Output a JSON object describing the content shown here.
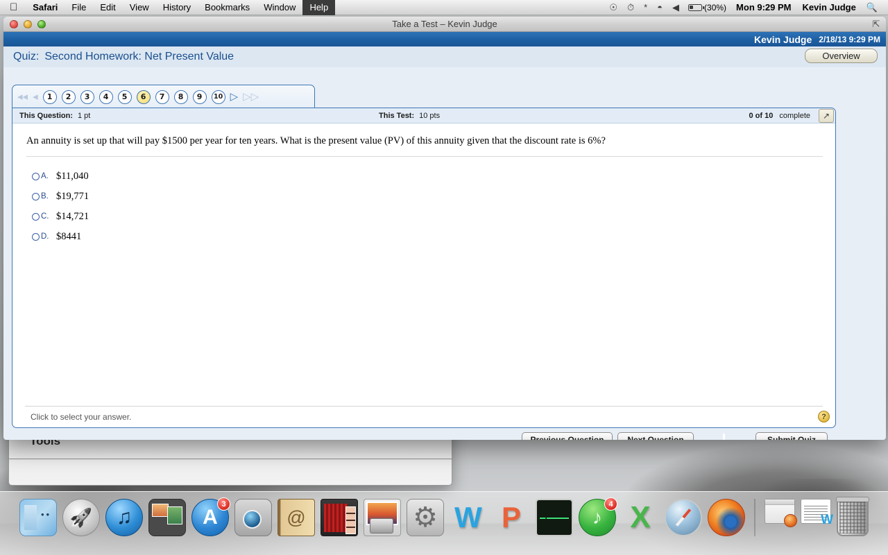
{
  "menubar": {
    "apple_icon": "apple-icon",
    "items": [
      {
        "label": "Safari",
        "bold": true,
        "active": false
      },
      {
        "label": "File",
        "bold": false,
        "active": false
      },
      {
        "label": "Edit",
        "bold": false,
        "active": false
      },
      {
        "label": "View",
        "bold": false,
        "active": false
      },
      {
        "label": "History",
        "bold": false,
        "active": false
      },
      {
        "label": "Bookmarks",
        "bold": false,
        "active": false
      },
      {
        "label": "Window",
        "bold": false,
        "active": false
      },
      {
        "label": "Help",
        "bold": false,
        "active": true
      }
    ],
    "status": {
      "dropbox_icon": "dropbox-icon",
      "timemachine_icon": "time-machine-icon",
      "bluetooth_icon": "bluetooth-icon",
      "wifi_icon": "wifi-icon",
      "volume_icon": "volume-icon",
      "battery_icon": "battery-icon",
      "battery_percent": "(30%)",
      "clock": "Mon 9:29 PM",
      "user": "Kevin Judge",
      "spotlight_icon": "search-icon"
    }
  },
  "window": {
    "title": "Take a Test – Kevin Judge",
    "close_label": "close",
    "minimize_label": "minimize",
    "zoom_label": "zoom",
    "fullscreen_icon": "fullscreen-icon"
  },
  "userbar": {
    "name": "Kevin Judge",
    "datetime": "2/18/13 9:29 PM"
  },
  "quiz_header": {
    "label": "Quiz:",
    "title": "Second Homework: Net Present Value",
    "overview_button": "Overview"
  },
  "question_nav": {
    "first_label": "first",
    "prev_label": "previous",
    "next_label": "next",
    "last_label": "last",
    "numbers": [
      "1",
      "2",
      "3",
      "4",
      "5",
      "6",
      "7",
      "8",
      "9",
      "10"
    ],
    "current": "6"
  },
  "score_bar": {
    "this_question_label": "This Question:",
    "this_question_value": "1 pt",
    "this_test_label": "This Test:",
    "this_test_value": "10 pts",
    "progress_value": "0 of 10",
    "progress_label": "complete",
    "expand_icon": "expand-icon"
  },
  "question": {
    "text": "An annuity is set up that will pay $1500 per year for ten years. What is the present value (PV) of this annuity given that the discount rate is 6%?",
    "choices": [
      {
        "letter": "A.",
        "value": "$11,040",
        "selected": false
      },
      {
        "letter": "B.",
        "value": "$19,771",
        "selected": false
      },
      {
        "letter": "C.",
        "value": "$14,721",
        "selected": false
      },
      {
        "letter": "D.",
        "value": "$8441",
        "selected": false
      }
    ],
    "hint": "Click to select your answer.",
    "help_icon": "?"
  },
  "actions": {
    "previous": "Previous Question",
    "next": "Next Question",
    "submit": "Submit Quiz"
  },
  "background_window": {
    "title": "Tools"
  },
  "dock": {
    "items": [
      {
        "name": "finder",
        "class": "ic-finder",
        "badge": ""
      },
      {
        "name": "launchpad",
        "class": "ic-launchpad",
        "badge": ""
      },
      {
        "name": "itunes",
        "class": "ic-itunes",
        "badge": ""
      },
      {
        "name": "mission-control",
        "class": "ic-mission",
        "badge": ""
      },
      {
        "name": "app-store",
        "class": "ic-appstore",
        "badge": "3"
      },
      {
        "name": "facetime",
        "class": "ic-facetime",
        "badge": ""
      },
      {
        "name": "contacts",
        "class": "ic-contacts",
        "badge": ""
      },
      {
        "name": "photo-booth",
        "class": "ic-photobooth",
        "badge": ""
      },
      {
        "name": "iphoto",
        "class": "ic-iphoto",
        "badge": ""
      },
      {
        "name": "system-preferences",
        "class": "ic-sysprefs",
        "badge": ""
      },
      {
        "name": "microsoft-word",
        "class": "ic-word",
        "badge": ""
      },
      {
        "name": "microsoft-powerpoint",
        "class": "ic-ppt",
        "badge": ""
      },
      {
        "name": "activity-monitor",
        "class": "ic-activity",
        "badge": ""
      },
      {
        "name": "spotify",
        "class": "ic-spotify",
        "badge": "4"
      },
      {
        "name": "microsoft-excel",
        "class": "ic-excel",
        "badge": ""
      },
      {
        "name": "safari",
        "class": "ic-safari",
        "badge": ""
      },
      {
        "name": "firefox",
        "class": "ic-firefox",
        "badge": ""
      }
    ],
    "minimized": [
      {
        "name": "minimized-firefox-window",
        "class": "ic-mini-ff"
      },
      {
        "name": "minimized-word-document",
        "class": "ic-mini-w"
      }
    ],
    "trash": {
      "name": "trash",
      "class": "ic-trash"
    }
  },
  "colors": {
    "accent_blue": "#1d5fa3",
    "panel_border": "#3f76b5",
    "current_question": "#f6de70",
    "link_blue": "#2a4d8f"
  }
}
